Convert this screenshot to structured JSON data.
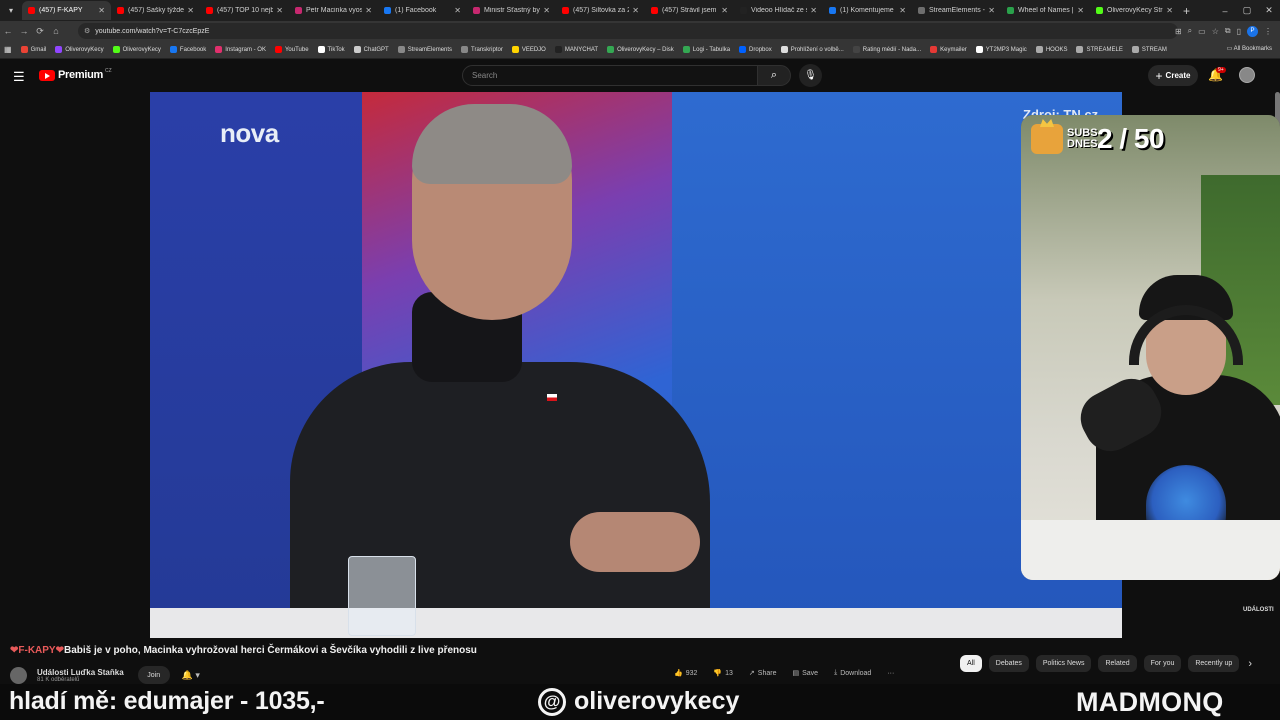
{
  "browser": {
    "tabs": [
      {
        "title": "(457) F-KAPY",
        "color": "#ff0000",
        "active": true
      },
      {
        "title": "(457) Šašky týždeň",
        "color": "#ff0000"
      },
      {
        "title": "(457) TOP 10 nejbi",
        "color": "#ff0000"
      },
      {
        "title": "Petr Macinka vyosil",
        "color": "#c7286f"
      },
      {
        "title": "(1) Facebook",
        "color": "#1877f2"
      },
      {
        "title": "Ministr Šťastný by",
        "color": "#c7286f"
      },
      {
        "title": "(457) Šiltovka za 20",
        "color": "#ff0000"
      },
      {
        "title": "(457) Strávil jsem tý",
        "color": "#ff0000"
      },
      {
        "title": "Videoo Hlídač ze sup",
        "color": "#222222"
      },
      {
        "title": "(1) Komentujeme p",
        "color": "#1877f2"
      },
      {
        "title": "StreamElements - C",
        "color": "#6e6e6e"
      },
      {
        "title": "Wheel of Names | F",
        "color": "#2aa14b"
      },
      {
        "title": "OliverovyKecy Stre",
        "color": "#53fc18"
      }
    ],
    "url": "youtube.com/watch?v=T-C7czcEpzE",
    "bookmarks": [
      {
        "label": "Gmail",
        "color": "#ea4335"
      },
      {
        "label": "OliverovyKecy",
        "color": "#9146ff"
      },
      {
        "label": "OliverovyKecy",
        "color": "#53fc18"
      },
      {
        "label": "Facebook",
        "color": "#1877f2"
      },
      {
        "label": "Instagram - OK",
        "color": "#e1306c"
      },
      {
        "label": "YouTube",
        "color": "#ff0000"
      },
      {
        "label": "TikTok",
        "color": "#ffffff"
      },
      {
        "label": "ChatGPT",
        "color": "#cccccc"
      },
      {
        "label": "StreamElements",
        "color": "#888888"
      },
      {
        "label": "Transkriptor",
        "color": "#888888"
      },
      {
        "label": "VEEDJO",
        "color": "#ffd400"
      },
      {
        "label": "MANYCHAT",
        "color": "#222222"
      },
      {
        "label": "OliverovyKecy – Disk",
        "color": "#34a853"
      },
      {
        "label": "Logi - Tabulka",
        "color": "#34a853"
      },
      {
        "label": "Dropbox",
        "color": "#0061ff"
      },
      {
        "label": "Prohlížení o volbě...",
        "color": "#dddddd"
      },
      {
        "label": "Rating médií - Nada...",
        "color": "#444444"
      },
      {
        "label": "Keymailer",
        "color": "#e53935"
      },
      {
        "label": "YT2MP3 Magic",
        "color": "#ffffff"
      },
      {
        "label": "HOOKS",
        "color": "#aaaaaa"
      },
      {
        "label": "STREAMELE",
        "color": "#aaaaaa"
      },
      {
        "label": "STREAM",
        "color": "#aaaaaa"
      }
    ],
    "all_bookmarks": "All Bookmarks",
    "profile_initial": "P"
  },
  "youtube": {
    "brand": "Premium",
    "region": "CZ",
    "search_placeholder": "Search",
    "create_label": "Create",
    "notifications": "9+"
  },
  "video": {
    "channel_logo": "nova",
    "source_tag": "Zdroj: TN.cz",
    "edit_label": "edit",
    "corner_mark": "UDÁLOSTI"
  },
  "webcam": {
    "subs_label": "SUBS DNES",
    "subs_count": "2 / 50"
  },
  "meta": {
    "title_prefix": "❤F-KAPY❤",
    "title": "Babiš je v poho, Macinka vyhrožoval herci Čermákovi a Ševčíka vyhodili z live přenosu",
    "channel": "Události Luďka Staňka",
    "subscribers": "81 K odběratelů",
    "join": "Join",
    "likes": "932",
    "dislikes": "13",
    "share": "Share",
    "save": "Save",
    "download": "Download",
    "chips": [
      "All",
      "Debates",
      "Politics News",
      "Related",
      "For you",
      "Recently up"
    ]
  },
  "stream": {
    "donation": "hladí mě: edumajer - 1035,-",
    "threads_handle": "oliverovykecy",
    "brand": "MADMONQ"
  }
}
